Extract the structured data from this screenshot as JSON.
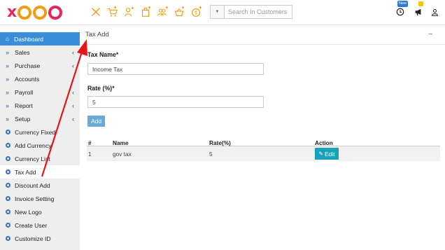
{
  "brand": {
    "logo_text": "xaoo"
  },
  "toolbar": {
    "icons": [
      "close-icon",
      "cart-plus-icon",
      "user-plus-icon",
      "bag-plus-icon",
      "users-plus-icon",
      "basket-plus-icon",
      "dollar-plus-icon"
    ],
    "search_placeholder": "Search In Customers",
    "new_badge": "New"
  },
  "sidebar": {
    "items": [
      {
        "label": "Dashboard",
        "type": "home",
        "active": true
      },
      {
        "label": "Sales",
        "type": "group"
      },
      {
        "label": "Purchase",
        "type": "group"
      },
      {
        "label": "Accounts",
        "type": "group"
      },
      {
        "label": "Payroll",
        "type": "group"
      },
      {
        "label": "Report",
        "type": "group"
      },
      {
        "label": "Setup",
        "type": "group"
      },
      {
        "label": "Currency Fixed",
        "type": "sub"
      },
      {
        "label": "Add Currency",
        "type": "sub"
      },
      {
        "label": "Currency List",
        "type": "sub"
      },
      {
        "label": "Tax Add",
        "type": "sub"
      },
      {
        "label": "Discount Add",
        "type": "sub"
      },
      {
        "label": "Invoice Setting",
        "type": "sub"
      },
      {
        "label": "New Logo",
        "type": "sub"
      },
      {
        "label": "Create User",
        "type": "sub"
      },
      {
        "label": "Customize ID",
        "type": "sub"
      }
    ]
  },
  "main": {
    "title": "Tax Add",
    "minimize": "–",
    "form": {
      "tax_name_label": "Tax Name*",
      "tax_name_value": "Income Tax",
      "rate_label": "Rate (%)*",
      "rate_value": "5",
      "add_button": "Add"
    },
    "table": {
      "headers": [
        "#",
        "Name",
        "Rate(%)",
        "Action"
      ],
      "rows": [
        {
          "num": "1",
          "name": "gov tax",
          "rate": "5",
          "action": "Edit"
        }
      ]
    }
  },
  "colors": {
    "accent": "#3a8dd8",
    "brand_pink": "#e8245b",
    "brand_orange": "#f39c12",
    "edit_button": "#17a2b8",
    "annotation_arrow": "#e8141b"
  }
}
